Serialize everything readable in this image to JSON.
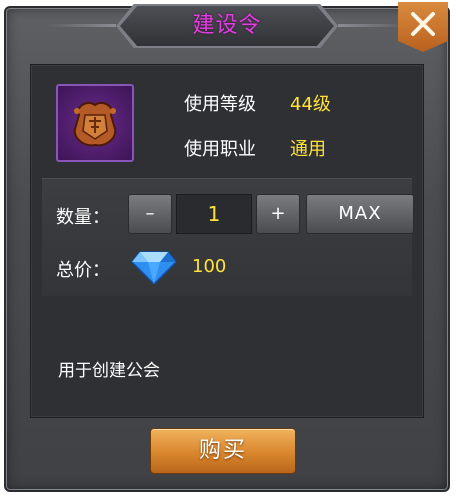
{
  "dialog": {
    "title": "建设令",
    "title_color": "#e03fe0",
    "close_icon": "close-icon"
  },
  "item": {
    "icon": "guild-token-icon",
    "level_label": "使用等级",
    "level_value": "44级",
    "class_label": "使用职业",
    "class_value": "通用",
    "value_color": "#ffe33a"
  },
  "purchase": {
    "quantity_label": "数量：",
    "minus_label": "–",
    "quantity_value": "1",
    "plus_label": "+",
    "max_label": "MAX",
    "price_label": "总价：",
    "price_icon": "diamond-icon",
    "price_value": "100"
  },
  "description": "用于创建公会",
  "buy_button": {
    "label": "购买",
    "color": "#d9862e"
  }
}
